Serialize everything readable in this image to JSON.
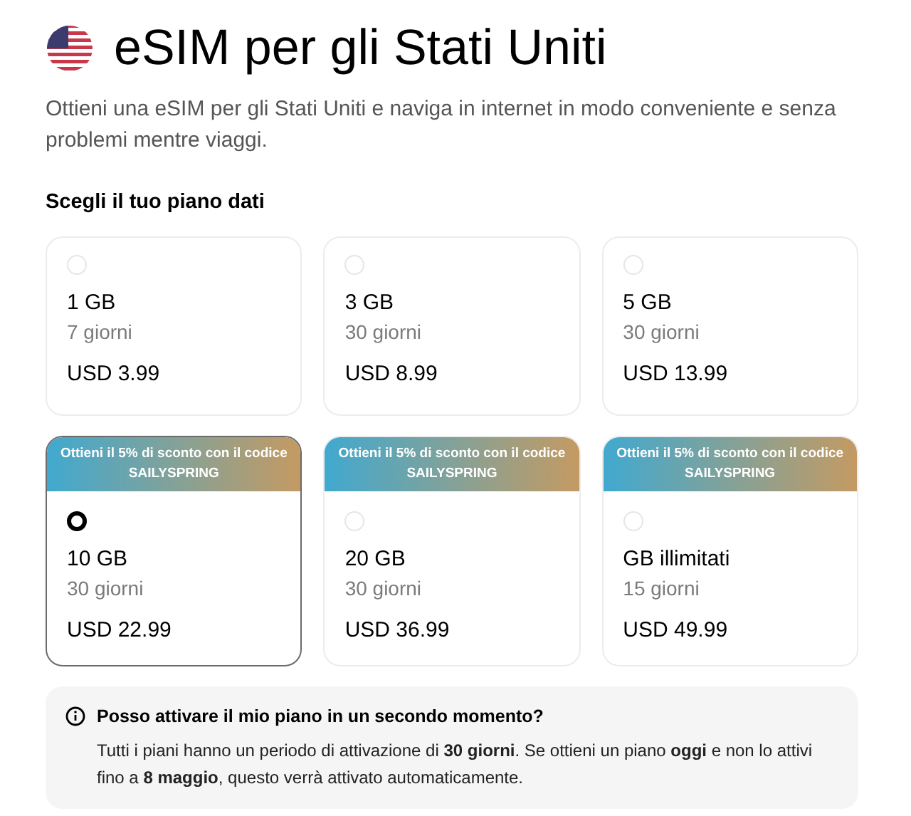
{
  "header": {
    "title": "eSIM per gli Stati Uniti",
    "subtitle": "Ottieni una eSIM per gli Stati Uniti e naviga in internet in modo conveniente e senza problemi mentre viaggi."
  },
  "plans_heading": "Scegli il tuo piano dati",
  "plans": [
    {
      "size": "1 GB",
      "duration": "7 giorni",
      "price": "USD 3.99",
      "selected": false
    },
    {
      "size": "3 GB",
      "duration": "30 giorni",
      "price": "USD 8.99",
      "selected": false
    },
    {
      "size": "5 GB",
      "duration": "30 giorni",
      "price": "USD 13.99",
      "selected": false
    },
    {
      "promo": {
        "text": "Ottieni il 5% di sconto con il codice",
        "code": "SAILYSPRING"
      },
      "size": "10 GB",
      "duration": "30 giorni",
      "price": "USD 22.99",
      "selected": true
    },
    {
      "promo": {
        "text": "Ottieni il 5% di sconto con il codice",
        "code": "SAILYSPRING"
      },
      "size": "20 GB",
      "duration": "30 giorni",
      "price": "USD 36.99",
      "selected": false
    },
    {
      "promo": {
        "text": "Ottieni il 5% di sconto con il codice",
        "code": "SAILYSPRING"
      },
      "size": "GB illimitati",
      "duration": "15 giorni",
      "price": "USD 49.99",
      "selected": false
    }
  ],
  "info": {
    "question": "Posso attivare il mio piano in un secondo momento?",
    "answer": "Tutti i piani hanno un periodo di attivazione di **30 giorni**. Se ottieni un piano **oggi** e non lo attivi fino a **8 maggio**, questo verrà attivato automaticamente."
  }
}
